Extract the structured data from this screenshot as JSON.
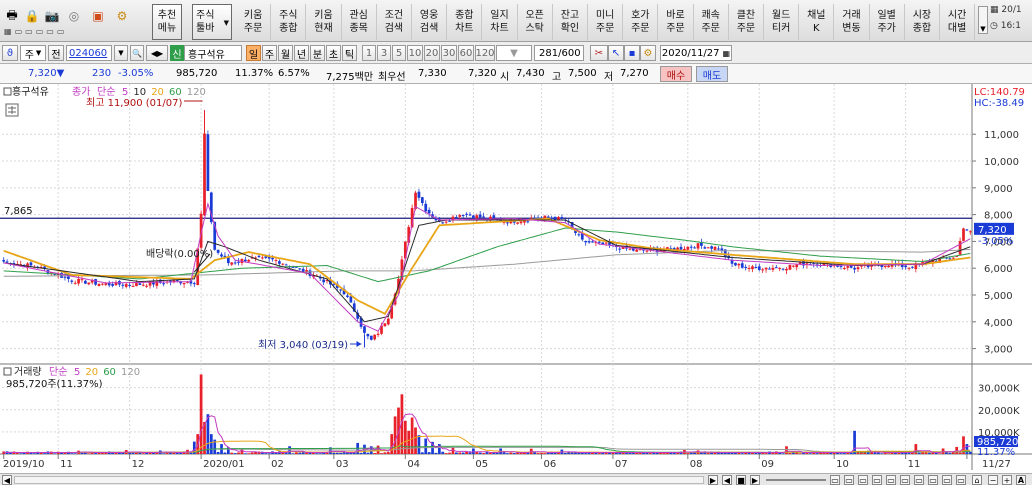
{
  "toolbar": {
    "icons": [
      "print-icon",
      "lock-icon",
      "camera-icon",
      "check-circle-icon",
      "monitor-icon",
      "gear-icon"
    ],
    "recommend_menu": [
      "추천",
      "메뉴"
    ],
    "stock_toolbar": [
      "주식",
      "툴바"
    ],
    "menus": [
      [
        "키움",
        "주문"
      ],
      [
        "주식",
        "종합"
      ],
      [
        "키움",
        "현재"
      ],
      [
        "관심",
        "종목"
      ],
      [
        "조건",
        "검색"
      ],
      [
        "영웅",
        "검색"
      ],
      [
        "종합",
        "차트"
      ],
      [
        "일지",
        "차트"
      ],
      [
        "오픈",
        "스탁"
      ],
      [
        "잔고",
        "확인"
      ],
      [
        "미니",
        "주문"
      ],
      [
        "호가",
        "주문"
      ],
      [
        "바로",
        "주문"
      ],
      [
        "쾌속",
        "주문"
      ],
      [
        "클찬",
        "주문"
      ],
      [
        "월드",
        "티커"
      ],
      [
        "채널",
        "K"
      ],
      [
        "거래",
        "변동"
      ],
      [
        "일별",
        "주가"
      ],
      [
        "시장",
        "종합"
      ],
      [
        "시간",
        "대별"
      ]
    ],
    "date_short": "20/1",
    "time_short": "16:1"
  },
  "controls": {
    "type_label": "주",
    "prev_label": "전",
    "stock_code": "024060",
    "new_badge": "신",
    "stock_name": "흥구석유",
    "period_buttons": [
      "일",
      "주",
      "월",
      "년",
      "분",
      "초",
      "틱"
    ],
    "selected_period": "일",
    "intervals": [
      "1",
      "3",
      "5",
      "10",
      "20",
      "30",
      "60",
      "120"
    ],
    "count": "281",
    "count_total": "/600",
    "date": "2020/11/27"
  },
  "quote": {
    "price": "7,320",
    "change_arrow": "▼",
    "change": "230",
    "change_rate": "-3.05%",
    "volume": "985,720",
    "vol_ratio": "11.37%",
    "turnover": "6.57%",
    "amount": "7,275백만",
    "best_ask_label": "최우선",
    "best_ask": "7,330",
    "best_bid": "7,320",
    "open_label": "시",
    "open": "7,430",
    "high_label": "고",
    "high": "7,500",
    "low_label": "저",
    "low": "7,270",
    "buy_label": "매수",
    "sell_label": "매도"
  },
  "colors": {
    "up": "#e8202a",
    "down": "#1a3bd6",
    "ma5": "#c23cc2",
    "ma10": "#2a2a2a",
    "ma20": "#e8a617",
    "ma60": "#2f9e4a",
    "ma120": "#9a9a9a",
    "hline": "#1c1c7a"
  },
  "chart_data": [
    {
      "type": "candlestick",
      "title": "흥구석유",
      "legend": [
        "종가",
        "단순",
        "5",
        "10",
        "20",
        "60",
        "120"
      ],
      "legend_colors": [
        "#c23cc2",
        "#c23cc2",
        "#c23cc2",
        "#2a2a2a",
        "#e8a617",
        "#2f9e4a",
        "#9a9a9a"
      ],
      "ylim": [
        2500,
        12800
      ],
      "yticks": [
        3000,
        4000,
        5000,
        6000,
        7000,
        8000,
        9000,
        10000,
        11000
      ],
      "ytick_labels": [
        "3,000",
        "4,000",
        "5,000",
        "6,000",
        "7,000",
        "8,000",
        "9,000",
        "10,000",
        "11,000"
      ],
      "lc_label": "LC:140.79",
      "hc_label": "HC:-38.49",
      "hline_value": 7865,
      "hline_label": "7,865",
      "last_price_label": "7,320",
      "last_change_label": "-3.05%",
      "annotations": {
        "high": "최고 11,900 (01/07)",
        "low": "최저 3,040 (03/19)",
        "dividend": "배당락(0.00%)"
      },
      "x_labels": [
        "2019/10",
        "11",
        "12",
        "2020/01",
        "02",
        "03",
        "04",
        "05",
        "06",
        "07",
        "08",
        "09",
        "10",
        "11",
        "11/27"
      ],
      "x_label_positions": [
        0,
        16,
        37,
        58,
        78,
        97,
        118,
        138,
        158,
        179,
        201,
        222,
        244,
        265,
        283
      ],
      "n_candles": 285,
      "path_anchors": [
        [
          0,
          6250
        ],
        [
          10,
          6050
        ],
        [
          20,
          5550
        ],
        [
          30,
          5400
        ],
        [
          40,
          5400
        ],
        [
          50,
          5500
        ],
        [
          56,
          5500
        ],
        [
          58,
          8000
        ],
        [
          59,
          11000
        ],
        [
          60,
          8800
        ],
        [
          62,
          6700
        ],
        [
          66,
          6200
        ],
        [
          72,
          6350
        ],
        [
          80,
          6300
        ],
        [
          86,
          6000
        ],
        [
          92,
          5700
        ],
        [
          100,
          5100
        ],
        [
          104,
          4200
        ],
        [
          106,
          3550
        ],
        [
          108,
          3300
        ],
        [
          110,
          3600
        ],
        [
          113,
          4200
        ],
        [
          116,
          5600
        ],
        [
          119,
          7600
        ],
        [
          121,
          8900
        ],
        [
          124,
          8200
        ],
        [
          128,
          7700
        ],
        [
          135,
          8050
        ],
        [
          140,
          7900
        ],
        [
          148,
          7750
        ],
        [
          160,
          7900
        ],
        [
          165,
          7800
        ],
        [
          170,
          7000
        ],
        [
          178,
          6850
        ],
        [
          186,
          6650
        ],
        [
          196,
          6700
        ],
        [
          204,
          6850
        ],
        [
          210,
          6750
        ],
        [
          214,
          6150
        ],
        [
          220,
          6000
        ],
        [
          230,
          6050
        ],
        [
          236,
          6200
        ],
        [
          242,
          6150
        ],
        [
          250,
          6000
        ],
        [
          260,
          6150
        ],
        [
          266,
          6050
        ],
        [
          274,
          6300
        ],
        [
          280,
          6450
        ],
        [
          282,
          7550
        ],
        [
          284,
          7320
        ]
      ],
      "ma_anchors": {
        "ma5": [
          [
            0,
            6200
          ],
          [
            30,
            5450
          ],
          [
            55,
            5500
          ],
          [
            58,
            7300
          ],
          [
            60,
            8400
          ],
          [
            63,
            7200
          ],
          [
            68,
            6300
          ],
          [
            90,
            5800
          ],
          [
            104,
            4000
          ],
          [
            110,
            3650
          ],
          [
            116,
            5000
          ],
          [
            121,
            8300
          ],
          [
            128,
            7800
          ],
          [
            150,
            7850
          ],
          [
            165,
            7700
          ],
          [
            175,
            6900
          ],
          [
            214,
            6300
          ],
          [
            240,
            6100
          ],
          [
            270,
            6150
          ],
          [
            284,
            7100
          ]
        ],
        "ma10": [
          [
            0,
            6200
          ],
          [
            40,
            5500
          ],
          [
            56,
            5600
          ],
          [
            60,
            7000
          ],
          [
            65,
            6800
          ],
          [
            75,
            6300
          ],
          [
            95,
            5600
          ],
          [
            106,
            4000
          ],
          [
            113,
            4200
          ],
          [
            122,
            7600
          ],
          [
            130,
            7800
          ],
          [
            165,
            7800
          ],
          [
            180,
            6850
          ],
          [
            214,
            6400
          ],
          [
            250,
            6100
          ],
          [
            270,
            6150
          ],
          [
            284,
            6800
          ]
        ],
        "ma20": [
          [
            0,
            6650
          ],
          [
            20,
            5750
          ],
          [
            55,
            5600
          ],
          [
            62,
            6300
          ],
          [
            72,
            6600
          ],
          [
            90,
            6150
          ],
          [
            104,
            4800
          ],
          [
            112,
            4300
          ],
          [
            120,
            6000
          ],
          [
            128,
            7600
          ],
          [
            160,
            7850
          ],
          [
            175,
            7050
          ],
          [
            190,
            6750
          ],
          [
            214,
            6500
          ],
          [
            250,
            6150
          ],
          [
            270,
            6150
          ],
          [
            284,
            6400
          ]
        ],
        "ma60": [
          [
            0,
            5900
          ],
          [
            40,
            5600
          ],
          [
            70,
            6000
          ],
          [
            95,
            6100
          ],
          [
            110,
            5500
          ],
          [
            125,
            5900
          ],
          [
            145,
            6800
          ],
          [
            165,
            7500
          ],
          [
            180,
            7350
          ],
          [
            200,
            7050
          ],
          [
            214,
            6800
          ],
          [
            240,
            6450
          ],
          [
            270,
            6250
          ],
          [
            284,
            6550
          ]
        ],
        "ma120": [
          [
            0,
            5700
          ],
          [
            60,
            5750
          ],
          [
            100,
            5900
          ],
          [
            120,
            5900
          ],
          [
            150,
            6150
          ],
          [
            180,
            6500
          ],
          [
            210,
            6650
          ],
          [
            240,
            6650
          ],
          [
            270,
            6600
          ],
          [
            284,
            6700
          ]
        ]
      }
    },
    {
      "type": "bar",
      "title": "거래량",
      "legend": [
        "거래량",
        "단순",
        "5",
        "20",
        "60",
        "120"
      ],
      "legend_colors": [
        "#2a2a2a",
        "#c23cc2",
        "#c23cc2",
        "#e8a617",
        "#2f9e4a",
        "#9a9a9a"
      ],
      "current_label": "985,720주(11.37%)",
      "ylim": [
        0,
        38000
      ],
      "yticks": [
        10000,
        20000,
        30000
      ],
      "ytick_labels": [
        "10,000K",
        "20,000K",
        "30,000K"
      ],
      "last_value_label": "985,720",
      "last_pct_label": "11.37%",
      "spikes": [
        [
          22,
          1500
        ],
        [
          36,
          1800
        ],
        [
          46,
          1600
        ],
        [
          54,
          1900
        ],
        [
          56,
          5600
        ],
        [
          57,
          9000
        ],
        [
          58,
          36000
        ],
        [
          59,
          14500
        ],
        [
          60,
          18000
        ],
        [
          61,
          9000
        ],
        [
          62,
          6500
        ],
        [
          64,
          4500
        ],
        [
          66,
          3000
        ],
        [
          70,
          2500
        ],
        [
          84,
          3500
        ],
        [
          96,
          3000
        ],
        [
          104,
          5000
        ],
        [
          106,
          4200
        ],
        [
          108,
          3500
        ],
        [
          110,
          3800
        ],
        [
          114,
          9000
        ],
        [
          115,
          17000
        ],
        [
          116,
          21000
        ],
        [
          117,
          27000
        ],
        [
          118,
          15000
        ],
        [
          119,
          10500
        ],
        [
          120,
          16500
        ],
        [
          121,
          12000
        ],
        [
          122,
          8500
        ],
        [
          124,
          7000
        ],
        [
          126,
          5500
        ],
        [
          128,
          4500
        ],
        [
          132,
          3000
        ],
        [
          138,
          2500
        ],
        [
          146,
          2500
        ],
        [
          155,
          2400
        ],
        [
          164,
          2000
        ],
        [
          200,
          1800
        ],
        [
          204,
          1600
        ],
        [
          230,
          3500
        ],
        [
          250,
          10500
        ],
        [
          254,
          1500
        ],
        [
          268,
          4500
        ],
        [
          276,
          2500
        ],
        [
          280,
          3200
        ],
        [
          282,
          8000
        ],
        [
          283,
          4500
        ],
        [
          284,
          1000
        ]
      ]
    }
  ]
}
